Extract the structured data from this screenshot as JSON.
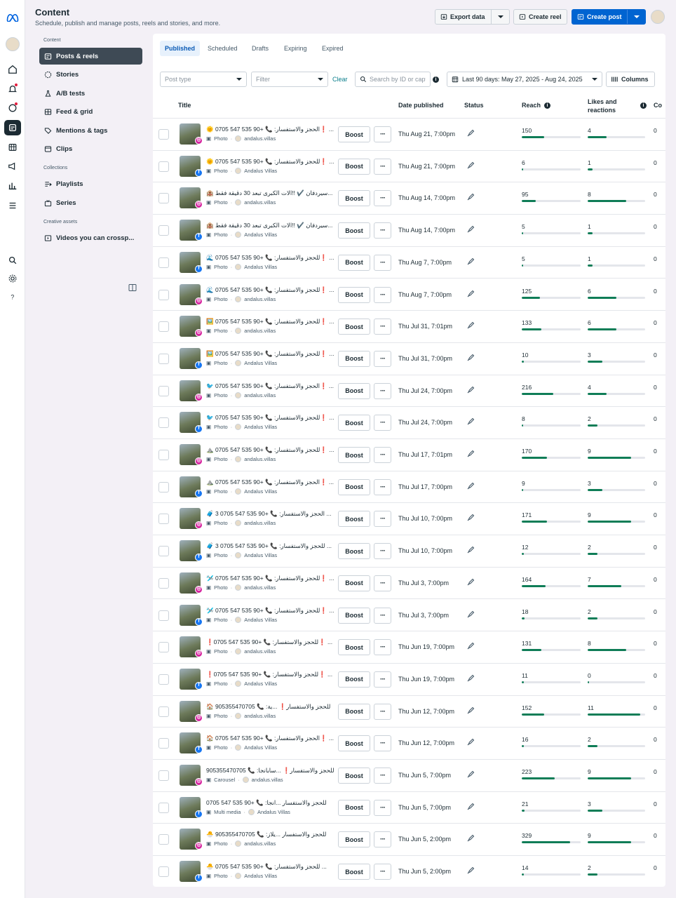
{
  "header": {
    "title": "Content",
    "subtitle": "Schedule, publish and manage posts, reels and stories, and more.",
    "export_label": "Export data",
    "create_reel_label": "Create reel",
    "create_post_label": "Create post"
  },
  "sidebar": {
    "content_heading": "Content",
    "items": [
      {
        "label": "Posts & reels",
        "icon": "posts-icon"
      },
      {
        "label": "Stories",
        "icon": "stories-icon"
      },
      {
        "label": "A/B tests",
        "icon": "flask-icon"
      },
      {
        "label": "Feed & grid",
        "icon": "grid-icon"
      },
      {
        "label": "Mentions & tags",
        "icon": "tag-icon"
      },
      {
        "label": "Clips",
        "icon": "clips-icon"
      }
    ],
    "collections_heading": "Collections",
    "collections": [
      {
        "label": "Playlists",
        "icon": "playlist-icon"
      },
      {
        "label": "Series",
        "icon": "series-icon"
      }
    ],
    "creative_heading": "Creative assets",
    "creative": [
      {
        "label": "Videos you can crossp...",
        "icon": "video-icon"
      }
    ]
  },
  "tabs": [
    "Published",
    "Scheduled",
    "Drafts",
    "Expiring",
    "Expired"
  ],
  "filters": {
    "post_type_placeholder": "Post type",
    "filter_placeholder": "Filter",
    "clear_label": "Clear",
    "search_placeholder": "Search by ID or capt",
    "date_range": "Last 90 days: May 27, 2025 - Aug 24, 2025",
    "columns_label": "Columns"
  },
  "table": {
    "columns": {
      "title": "Title",
      "date": "Date published",
      "status": "Status",
      "reach": "Reach",
      "likes": "Likes and reactions",
      "comments": "Co"
    },
    "boost_label": "Boost",
    "more_label": "···",
    "rows": [
      {
        "title": "🌞 0705 547 535 90+ 📞 :الحجز والاستفسار❗ ...",
        "type": "Photo",
        "account": "andalus.villas",
        "platform": "ig",
        "date": "Thu Aug 21, 7:00pm",
        "reach": 150,
        "likes": 4,
        "comments": 0
      },
      {
        "title": "🌞 0705 547 535 90+ 📞 :للحجز والاستفسار❗ ...",
        "type": "Photo",
        "account": "Andalus Villas",
        "platform": "fb",
        "date": "Thu Aug 21, 7:00pm",
        "reach": 6,
        "likes": 1,
        "comments": 0
      },
      {
        "title": "🏨 سيردفان ✔️ !!الات الكبرى تبعد 30 دقيقة فقط...",
        "type": "Photo",
        "account": "andalus.villas",
        "platform": "ig",
        "date": "Thu Aug 14, 7:00pm",
        "reach": 95,
        "likes": 8,
        "comments": 0
      },
      {
        "title": "🏨 سيردفان ✔️ !!الات الكبرى تبعد 30 دقيقة فقط...",
        "type": "Photo",
        "account": "Andalus Villas",
        "platform": "fb",
        "date": "Thu Aug 14, 7:00pm",
        "reach": 5,
        "likes": 1,
        "comments": 0
      },
      {
        "title": "🌊 0705 547 535 90+ 📞 :للحجز والاستفسار❗ ...",
        "type": "Photo",
        "account": "Andalus Villas",
        "platform": "fb",
        "date": "Thu Aug 7, 7:00pm",
        "reach": 5,
        "likes": 1,
        "comments": 0
      },
      {
        "title": "🌊 0705 547 535 90+ 📞 :للحجز والاستفسار❗ ...",
        "type": "Photo",
        "account": "andalus.villas",
        "platform": "ig",
        "date": "Thu Aug 7, 7:00pm",
        "reach": 125,
        "likes": 6,
        "comments": 0
      },
      {
        "title": "🖼️ 0705 547 535 90+ 📞 :للحجز والاستفسار❗ ...",
        "type": "Photo",
        "account": "andalus.villas",
        "platform": "ig",
        "date": "Thu Jul 31, 7:01pm",
        "reach": 133,
        "likes": 6,
        "comments": 0
      },
      {
        "title": "🖼️ 0705 547 535 90+ 📞 :للحجز والاستفسار❗ ...",
        "type": "Photo",
        "account": "Andalus Villas",
        "platform": "fb",
        "date": "Thu Jul 31, 7:00pm",
        "reach": 10,
        "likes": 3,
        "comments": 0
      },
      {
        "title": "🐦 0705 547 535 90+ 📞 :الحجز والاستفسار❗ ...",
        "type": "Photo",
        "account": "andalus.villas",
        "platform": "ig",
        "date": "Thu Jul 24, 7:00pm",
        "reach": 216,
        "likes": 4,
        "comments": 0
      },
      {
        "title": "🐦 0705 547 535 90+ 📞 :للحجز والاستفسار❗ ...",
        "type": "Photo",
        "account": "Andalus Villas",
        "platform": "fb",
        "date": "Thu Jul 24, 7:00pm",
        "reach": 8,
        "likes": 2,
        "comments": 0
      },
      {
        "title": "⛰️ 0705 547 535 90+ 📞 :للحجز والاستفسار❗ ...",
        "type": "Photo",
        "account": "andalus.villas",
        "platform": "ig",
        "date": "Thu Jul 17, 7:01pm",
        "reach": 170,
        "likes": 9,
        "comments": 0
      },
      {
        "title": "⛰️ 0705 547 535 90+ 📞 :الحجز والاستفسار❗ ...",
        "type": "Photo",
        "account": "Andalus Villas",
        "platform": "fb",
        "date": "Thu Jul 17, 7:00pm",
        "reach": 9,
        "likes": 3,
        "comments": 0
      },
      {
        "title": "🧳 3 0705 547 535 90+ 📞 :الحجز والاستفسار ...",
        "type": "Photo",
        "account": "andalus.villas",
        "platform": "ig",
        "date": "Thu Jul 10, 7:00pm",
        "reach": 171,
        "likes": 9,
        "comments": 0
      },
      {
        "title": "🧳 3 0705 547 535 90+ 📞 :للحجز والاستفسار ...",
        "type": "Photo",
        "account": "Andalus Villas",
        "platform": "fb",
        "date": "Thu Jul 10, 7:00pm",
        "reach": 12,
        "likes": 2,
        "comments": 0
      },
      {
        "title": "🛩️ 0705 547 535 90+ 📞 :للحجز والاستفسار❗ ...",
        "type": "Photo",
        "account": "andalus.villas",
        "platform": "ig",
        "date": "Thu Jul 3, 7:00pm",
        "reach": 164,
        "likes": 7,
        "comments": 0
      },
      {
        "title": "🛩️ 0705 547 535 90+ 📞 :للحجز والاستفسار❗ ...",
        "type": "Photo",
        "account": "Andalus Villas",
        "platform": "fb",
        "date": "Thu Jul 3, 7:00pm",
        "reach": 18,
        "likes": 2,
        "comments": 0
      },
      {
        "title": "❗0705 547 535 90+ 📞 :للحجز والاستفسار❗ ...",
        "type": "Photo",
        "account": "andalus.villas",
        "platform": "ig",
        "date": "Thu Jun 19, 7:00pm",
        "reach": 131,
        "likes": 8,
        "comments": 0
      },
      {
        "title": "❗0705 547 535 90+ 📞 :للحجز والاستفسار❗ ...",
        "type": "Photo",
        "account": "Andalus Villas",
        "platform": "fb",
        "date": "Thu Jun 19, 7:00pm",
        "reach": 11,
        "likes": 0,
        "comments": 0
      },
      {
        "title": "🏠 905355470705 📞 :للحجز والاستفسار❗ ...ية",
        "type": "Photo",
        "account": "andalus.villas",
        "platform": "ig",
        "date": "Thu Jun 12, 7:00pm",
        "reach": 152,
        "likes": 11,
        "comments": 0
      },
      {
        "title": "🏠 0705 547 535 90+ 📞 :الحجز والاستفسار❗ ...",
        "type": "Photo",
        "account": "Andalus Villas",
        "platform": "fb",
        "date": "Thu Jun 12, 7:00pm",
        "reach": 16,
        "likes": 2,
        "comments": 0
      },
      {
        "title": "905355470705 📞 :للحجز والاستفسار❗ ...سابانجا",
        "type": "Carousel",
        "account": "andalus.villas",
        "platform": "ig",
        "date": "Thu Jun 5, 7:00pm",
        "reach": 223,
        "likes": 9,
        "comments": 0
      },
      {
        "title": "0705 547 535 90+ 📞 :للحجز والاستفسار ...انجا",
        "type": "Multi media",
        "account": "Andalus Villas",
        "platform": "fb",
        "date": "Thu Jun 5, 7:00pm",
        "reach": 21,
        "likes": 3,
        "comments": 0
      },
      {
        "title": "🐣 905355470705 📞 :للحجز والاستفسار ...يلاز",
        "type": "Photo",
        "account": "andalus.villas",
        "platform": "ig",
        "date": "Thu Jun 5, 2:00pm",
        "reach": 329,
        "likes": 9,
        "comments": 0
      },
      {
        "title": "🐣 0705 547 535 90+ 📞 :للحجز والاستفسار ...",
        "type": "Photo",
        "account": "Andalus Villas",
        "platform": "fb",
        "date": "Thu Jun 5, 2:00pm",
        "reach": 14,
        "likes": 2,
        "comments": 0
      }
    ]
  },
  "colors": {
    "accent": "#0064d1",
    "bar_fill": "#0f7d57",
    "active_nav": "#3e4a55"
  }
}
